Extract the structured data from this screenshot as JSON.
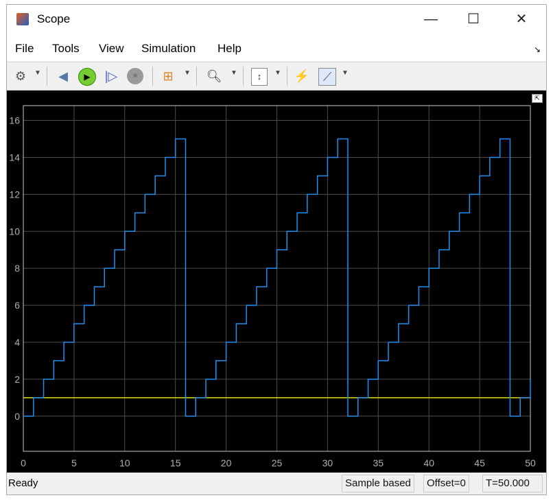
{
  "window": {
    "title": "Scope"
  },
  "menu": [
    "File",
    "Tools",
    "View",
    "Simulation",
    "Help"
  ],
  "toolbar": {
    "icons": [
      "gear-icon",
      "step-back-icon",
      "run-icon",
      "step-forward-icon",
      "stop-icon",
      "signal-hierarchy-icon",
      "zoom-icon",
      "scale-axes-icon",
      "trigger-icon",
      "measurement-icon"
    ]
  },
  "status": {
    "state": "Ready",
    "mode": "Sample based",
    "offset": "Offset=0",
    "time": "T=50.000"
  },
  "colors": {
    "background": "#000000",
    "grid": "#4d4d4d",
    "axis_text": "#b0b0b0",
    "series1": "#1f8ff0",
    "series2": "#e0e000"
  },
  "chart_data": {
    "type": "line",
    "title": "",
    "xlabel": "",
    "ylabel": "",
    "xlim": [
      0,
      50
    ],
    "ylim": [
      -1.9,
      16.8
    ],
    "grid": true,
    "xticks": [
      0,
      5,
      10,
      15,
      20,
      25,
      30,
      35,
      40,
      45,
      50
    ],
    "yticks": [
      0,
      2,
      4,
      6,
      8,
      10,
      12,
      14,
      16
    ],
    "series": [
      {
        "style": "stairs",
        "x": [
          0,
          1,
          2,
          3,
          4,
          5,
          6,
          7,
          8,
          9,
          10,
          11,
          12,
          13,
          14,
          15,
          16,
          17,
          18,
          19,
          20,
          21,
          22,
          23,
          24,
          25,
          26,
          27,
          28,
          29,
          30,
          31,
          32,
          33,
          34,
          35,
          36,
          37,
          38,
          39,
          40,
          41,
          42,
          43,
          44,
          45,
          46,
          47,
          48,
          49,
          50
        ],
        "y": [
          0,
          1,
          2,
          3,
          4,
          5,
          6,
          7,
          8,
          9,
          10,
          11,
          12,
          13,
          14,
          15,
          0,
          1,
          2,
          3,
          4,
          5,
          6,
          7,
          8,
          9,
          10,
          11,
          12,
          13,
          14,
          15,
          0,
          1,
          2,
          3,
          4,
          5,
          6,
          7,
          8,
          9,
          10,
          11,
          12,
          13,
          14,
          15,
          0,
          1,
          2
        ]
      },
      {
        "style": "line",
        "x": [
          0,
          50
        ],
        "y": [
          1,
          1
        ]
      }
    ]
  }
}
